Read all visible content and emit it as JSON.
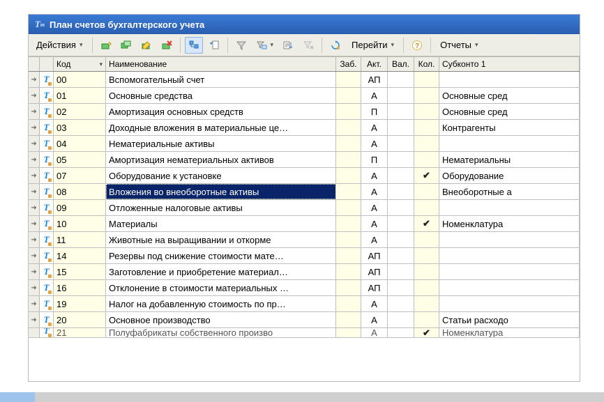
{
  "window": {
    "title": "План счетов бухгалтерского учета"
  },
  "toolbar": {
    "actions_label": "Действия",
    "go_label": "Перейти",
    "reports_label": "Отчеты"
  },
  "columns": {
    "code": "Код",
    "name": "Наименование",
    "zab": "Заб.",
    "akt": "Акт.",
    "val": "Вал.",
    "kol": "Кол.",
    "sub1": "Субконто 1"
  },
  "rows": [
    {
      "code": "00",
      "name": "Вспомогательный счет",
      "akt": "АП",
      "val": "",
      "kol": "",
      "sub": ""
    },
    {
      "code": "01",
      "name": "Основные средства",
      "akt": "А",
      "val": "",
      "kol": "",
      "sub": "Основные сред"
    },
    {
      "code": "02",
      "name": "Амортизация основных средств",
      "akt": "П",
      "val": "",
      "kol": "",
      "sub": "Основные сред"
    },
    {
      "code": "03",
      "name": "Доходные вложения в материальные це…",
      "akt": "А",
      "val": "",
      "kol": "",
      "sub": "Контрагенты"
    },
    {
      "code": "04",
      "name": "Нематериальные активы",
      "akt": "А",
      "val": "",
      "kol": "",
      "sub": ""
    },
    {
      "code": "05",
      "name": "Амортизация нематериальных активов",
      "akt": "П",
      "val": "",
      "kol": "",
      "sub": "Нематериальны"
    },
    {
      "code": "07",
      "name": "Оборудование к установке",
      "akt": "А",
      "val": "",
      "kol": "✔",
      "sub": "Оборудование"
    },
    {
      "code": "08",
      "name": "Вложения во внеоборотные активы",
      "akt": "А",
      "val": "",
      "kol": "",
      "sub": "Внеоборотные а",
      "selected": true
    },
    {
      "code": "09",
      "name": "Отложенные налоговые активы",
      "akt": "А",
      "val": "",
      "kol": "",
      "sub": ""
    },
    {
      "code": "10",
      "name": "Материалы",
      "akt": "А",
      "val": "",
      "kol": "✔",
      "sub": "Номенклатура"
    },
    {
      "code": "11",
      "name": "Животные на выращивании и откорме",
      "akt": "А",
      "val": "",
      "kol": "",
      "sub": ""
    },
    {
      "code": "14",
      "name": "Резервы под снижение стоимости мате…",
      "akt": "АП",
      "val": "",
      "kol": "",
      "sub": ""
    },
    {
      "code": "15",
      "name": "Заготовление и приобретение материал…",
      "akt": "АП",
      "val": "",
      "kol": "",
      "sub": ""
    },
    {
      "code": "16",
      "name": "Отклонение в стоимости материальных …",
      "akt": "АП",
      "val": "",
      "kol": "",
      "sub": ""
    },
    {
      "code": "19",
      "name": "Налог на добавленную стоимость по пр…",
      "akt": "А",
      "val": "",
      "kol": "",
      "sub": ""
    },
    {
      "code": "20",
      "name": "Основное производство",
      "akt": "А",
      "val": "",
      "kol": "",
      "sub": "Статьи расходо"
    }
  ],
  "cutoff": {
    "code": "21",
    "name": "Полуфабрикаты собственного произво",
    "akt": "А",
    "kol": "✔",
    "sub": "Номенклатура"
  }
}
